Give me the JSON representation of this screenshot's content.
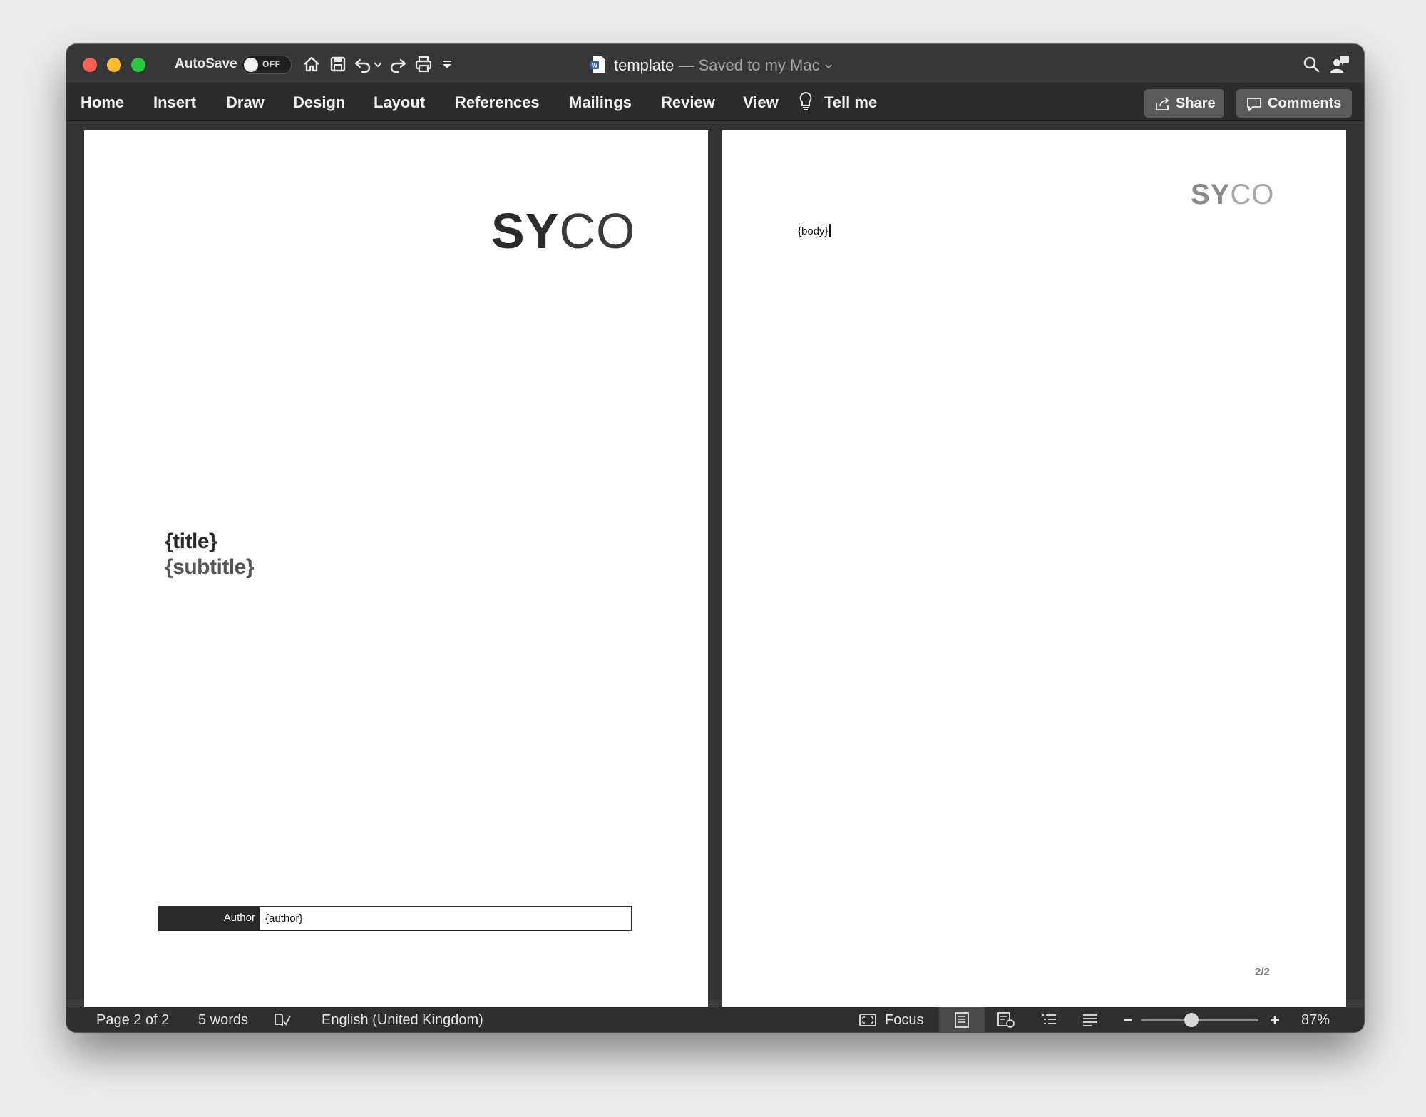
{
  "titlebar": {
    "autosave_label": "AutoSave",
    "autosave_state": "OFF",
    "doc_name": "template",
    "doc_status": " — Saved to my Mac"
  },
  "menu": {
    "items": [
      "Home",
      "Insert",
      "Draw",
      "Design",
      "Layout",
      "References",
      "Mailings",
      "Review",
      "View"
    ],
    "tell_me": "Tell me",
    "share": "Share",
    "comments": "Comments"
  },
  "page1": {
    "logo_bold": "SY",
    "logo_light": "CO",
    "title": "{title}",
    "subtitle": "{subtitle}",
    "author_label": "Author",
    "author_value": "{author}"
  },
  "page2": {
    "logo_bold": "SY",
    "logo_light": "CO",
    "body": "{body}",
    "page_number": "2/2"
  },
  "status": {
    "page": "Page 2 of 2",
    "words": "5 words",
    "language": "English (United Kingdom)",
    "focus": "Focus",
    "zoom": "87%",
    "zoom_level_percent": 87
  },
  "colors": {
    "window_bg": "#3b3b3b",
    "menubar_bg": "#2c2c2c",
    "button_bg": "#5a5a5a",
    "close": "#fe5f57",
    "minimize": "#febc2e",
    "zoom": "#28c840"
  }
}
